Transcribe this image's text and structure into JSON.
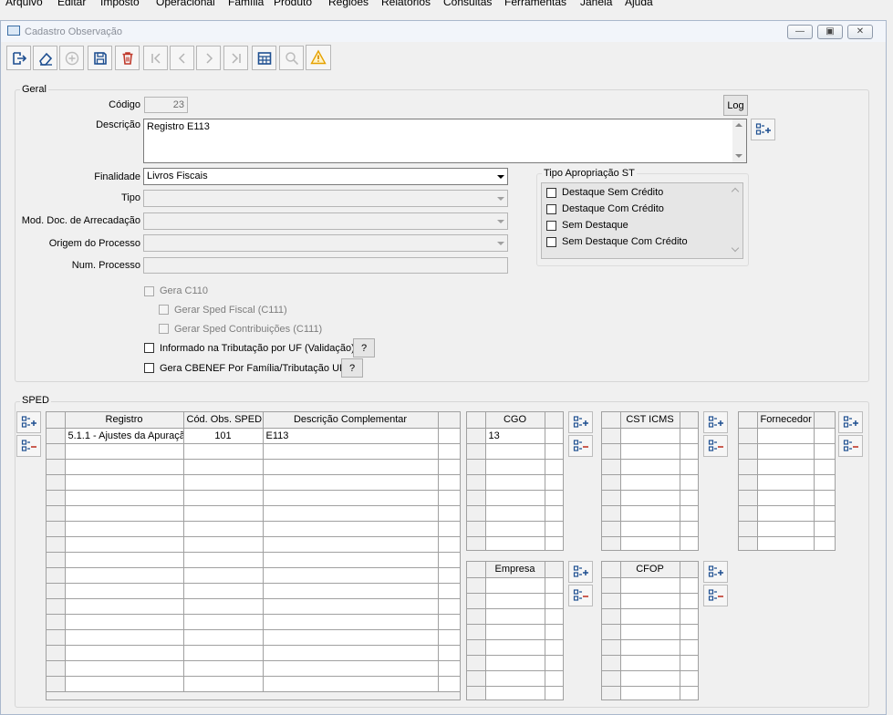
{
  "menu": [
    "Arquivo",
    "Editar",
    "Imposto",
    "Operacional",
    "Família",
    "Produto",
    "Regiões",
    "Relatórios",
    "Consultas",
    "Ferramentas",
    "Janela",
    "Ajuda"
  ],
  "window": {
    "title": "Cadastro Observação"
  },
  "geral": {
    "legend": "Geral",
    "codigo_label": "Código",
    "codigo_value": "23",
    "log_label": "Log",
    "descricao_label": "Descrição",
    "descricao_value": "Registro E113",
    "finalidade_label": "Finalidade",
    "finalidade_value": "Livros Fiscais",
    "tipo_label": "Tipo",
    "tipo_value": "",
    "mod_doc_label": "Mod. Doc. de Arrecadação",
    "mod_doc_value": "",
    "origem_label": "Origem do Processo",
    "origem_value": "",
    "num_processo_label": "Num. Processo",
    "num_processo_value": "",
    "gera_c110": "Gera C110",
    "gerar_sped_fiscal": "Gerar Sped Fiscal (C111)",
    "gerar_sped_contrib": "Gerar Sped Contribuições (C111)",
    "informado_trib": "Informado na Tributação por UF (Validação)",
    "gera_cbenef": "Gera CBENEF Por Família/Tributação UF",
    "help_label": "?"
  },
  "tipo_apropriacao": {
    "legend": "Tipo Apropriação ST",
    "items": [
      "Destaque Sem Crédito",
      "Destaque Com Crédito",
      "Sem Destaque",
      "Sem Destaque Com Crédito"
    ]
  },
  "sped": {
    "legend": "SPED",
    "registro_grid": {
      "columns": [
        "Registro",
        "Cód. Obs. SPED",
        "Descrição Complementar"
      ],
      "rows": [
        [
          "5.1.1 - Ajustes da Apuraçã",
          "101",
          "E113"
        ]
      ]
    },
    "cgo_grid": {
      "column": "CGO",
      "rows": [
        "13"
      ]
    },
    "cst_grid": {
      "column": "CST ICMS",
      "rows": []
    },
    "fornecedor_grid": {
      "column": "Fornecedor",
      "rows": []
    },
    "empresa_grid": {
      "column": "Empresa",
      "rows": []
    },
    "cfop_grid": {
      "column": "CFOP",
      "rows": []
    }
  }
}
